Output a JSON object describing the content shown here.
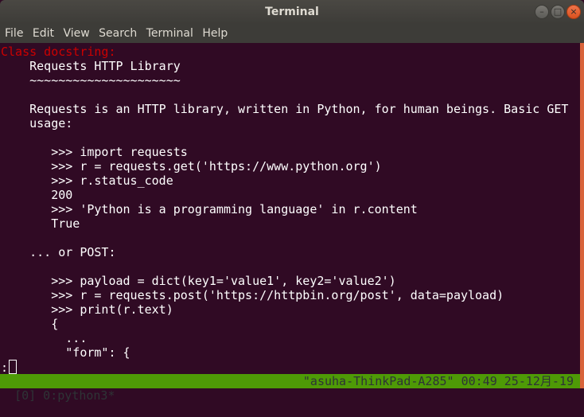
{
  "window": {
    "title": "Terminal"
  },
  "menu": [
    "File",
    "Edit",
    "View",
    "Search",
    "Terminal",
    "Help"
  ],
  "lines": [
    {
      "text": "Class docstring:",
      "color": "red"
    },
    {
      "text": "    Requests HTTP Library"
    },
    {
      "text": "    ~~~~~~~~~~~~~~~~~~~~~"
    },
    {
      "text": ""
    },
    {
      "text": "    Requests is an HTTP library, written in Python, for human beings. Basic GET"
    },
    {
      "text": "    usage:"
    },
    {
      "text": ""
    },
    {
      "text": "       >>> import requests"
    },
    {
      "text": "       >>> r = requests.get('https://www.python.org')"
    },
    {
      "text": "       >>> r.status_code"
    },
    {
      "text": "       200"
    },
    {
      "text": "       >>> 'Python is a programming language' in r.content"
    },
    {
      "text": "       True"
    },
    {
      "text": ""
    },
    {
      "text": "    ... or POST:"
    },
    {
      "text": ""
    },
    {
      "text": "       >>> payload = dict(key1='value1', key2='value2')"
    },
    {
      "text": "       >>> r = requests.post('https://httpbin.org/post', data=payload)"
    },
    {
      "text": "       >>> print(r.text)"
    },
    {
      "text": "       {"
    },
    {
      "text": "         ..."
    },
    {
      "text": "         \"form\": {"
    }
  ],
  "prompt": ":",
  "tmux": {
    "left": "[0] 0:python3*",
    "right": "\"asuha-ThinkPad-A285\" 00:49 25-12月-19"
  }
}
